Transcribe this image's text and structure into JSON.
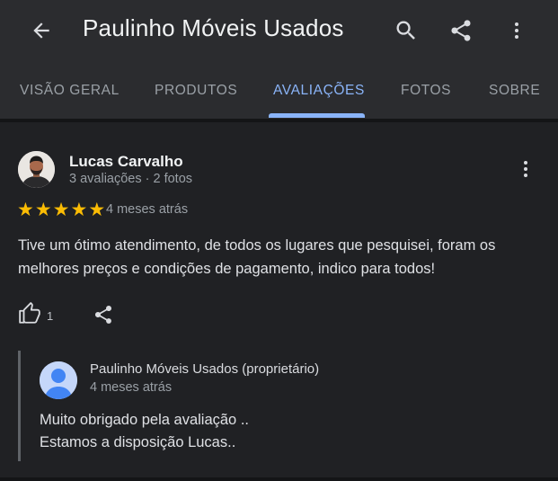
{
  "appbar": {
    "title": "Paulinho Móveis Usados",
    "icons": [
      "back-arrow-icon",
      "search-icon",
      "share-icon",
      "more-vert-icon"
    ]
  },
  "tabs": [
    {
      "label": "VISÃO GERAL",
      "active": false
    },
    {
      "label": "PRODUTOS",
      "active": false
    },
    {
      "label": "AVALIAÇÕES",
      "active": true
    },
    {
      "label": "FOTOS",
      "active": false
    },
    {
      "label": "SOBRE",
      "active": false
    }
  ],
  "review": {
    "author": "Lucas Carvalho",
    "author_meta": "3 avaliações · 2 fotos",
    "rating": 5,
    "rating_max": 5,
    "date": "4 meses atrás",
    "text": "Tive um ótimo atendimento, de todos os lugares que pesquisei, foram os melhores preços e condições de pagamento, indico para todos!",
    "likes": "1"
  },
  "owner_reply": {
    "name": "Paulinho Móveis Usados (proprietário)",
    "date": "4 meses atrás",
    "lines": [
      "Muito obrigado pela avaliação ..",
      "Estamos a disposição Lucas.."
    ]
  },
  "colors": {
    "background": "#202124",
    "appbar": "#2b2c2f",
    "accent": "#8ab4f8",
    "star": "#fbbc04",
    "text_secondary": "#9aa0a6"
  }
}
